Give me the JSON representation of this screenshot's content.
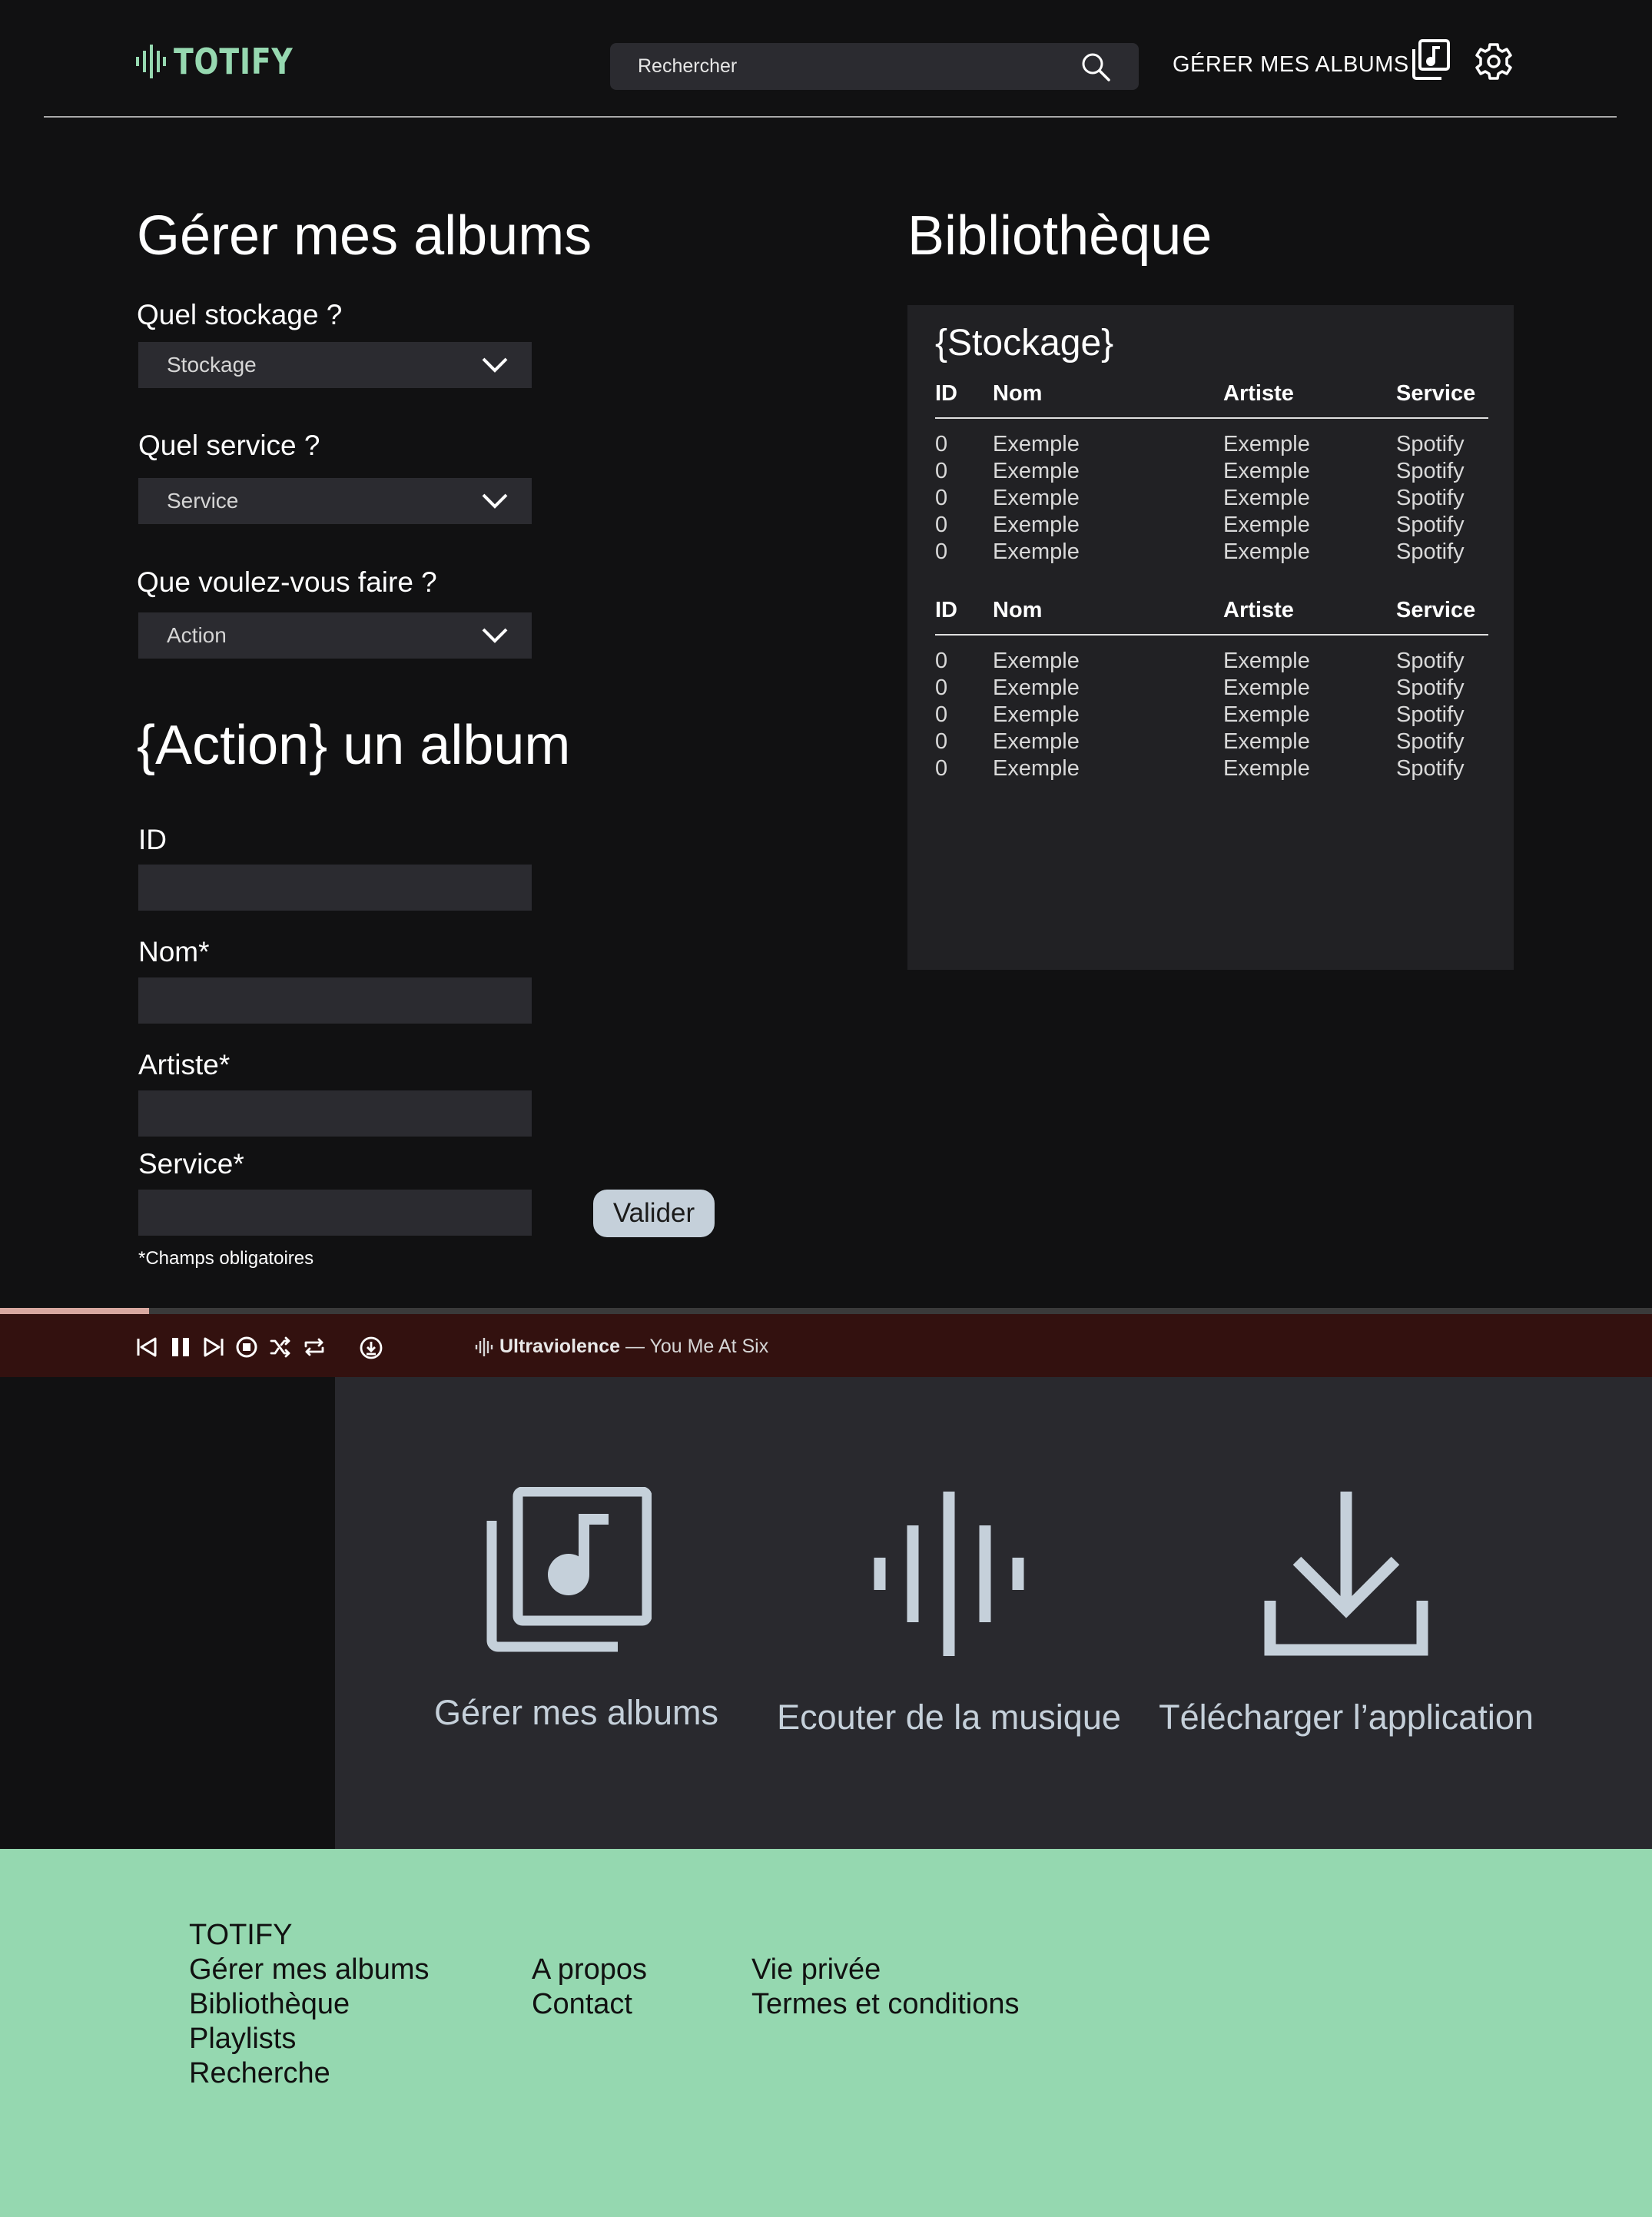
{
  "header": {
    "logo_text": "TOTIFY",
    "search_placeholder": "Rechercher",
    "nav_link": "GÉRER MES ALBUMS",
    "icons": [
      "album-library-icon",
      "gear-icon",
      "search-icon"
    ]
  },
  "manage": {
    "title": "Gérer mes albums",
    "storage_label": "Quel stockage ?",
    "storage_value": "Stockage",
    "service_label": "Quel service ?",
    "service_value": "Service",
    "action_label": "Que voulez-vous faire ?",
    "action_value": "Action"
  },
  "album_form": {
    "title": "{Action} un album",
    "id_label": "ID",
    "name_label": "Nom*",
    "artist_label": "Artiste*",
    "service_label": "Service*",
    "submit_label": "Valider",
    "note": "*Champs obligatoires"
  },
  "library": {
    "title": "Bibliothèque",
    "panel_title": "{Stockage}",
    "columns": [
      "ID",
      "Nom",
      "Artiste",
      "Service"
    ],
    "tables": [
      {
        "rows": [
          [
            "0",
            "Exemple",
            "Exemple",
            "Spotify"
          ],
          [
            "0",
            "Exemple",
            "Exemple",
            "Spotify"
          ],
          [
            "0",
            "Exemple",
            "Exemple",
            "Spotify"
          ],
          [
            "0",
            "Exemple",
            "Exemple",
            "Spotify"
          ],
          [
            "0",
            "Exemple",
            "Exemple",
            "Spotify"
          ]
        ]
      },
      {
        "rows": [
          [
            "0",
            "Exemple",
            "Exemple",
            "Spotify"
          ],
          [
            "0",
            "Exemple",
            "Exemple",
            "Spotify"
          ],
          [
            "0",
            "Exemple",
            "Exemple",
            "Spotify"
          ],
          [
            "0",
            "Exemple",
            "Exemple",
            "Spotify"
          ],
          [
            "0",
            "Exemple",
            "Exemple",
            "Spotify"
          ]
        ]
      }
    ]
  },
  "player": {
    "progress": 0.09,
    "track": "Ultraviolence",
    "separator": " — ",
    "artist": "You Me At Six",
    "controls": [
      "previous-icon",
      "pause-icon",
      "next-icon",
      "stop-icon",
      "shuffle-icon",
      "repeat-icon",
      "download-icon"
    ]
  },
  "features": {
    "albums_label": "Gérer mes albums",
    "listen_label": "Ecouter de la musique",
    "download_label": "Télécharger l’application"
  },
  "footer": {
    "col1": [
      "TOTIFY",
      "Gérer mes albums",
      "Bibliothèque",
      "Playlists",
      "Recherche"
    ],
    "col2": [
      "A propos",
      "Contact"
    ],
    "col3": [
      "Vie privée",
      "Termes et conditions"
    ]
  },
  "colors": {
    "background": "#111112",
    "surface": "#2b2b30",
    "panel": "#212124",
    "accent": "#95d8b0",
    "player_bar": "#33110f",
    "icon_light": "#c5d0da"
  }
}
